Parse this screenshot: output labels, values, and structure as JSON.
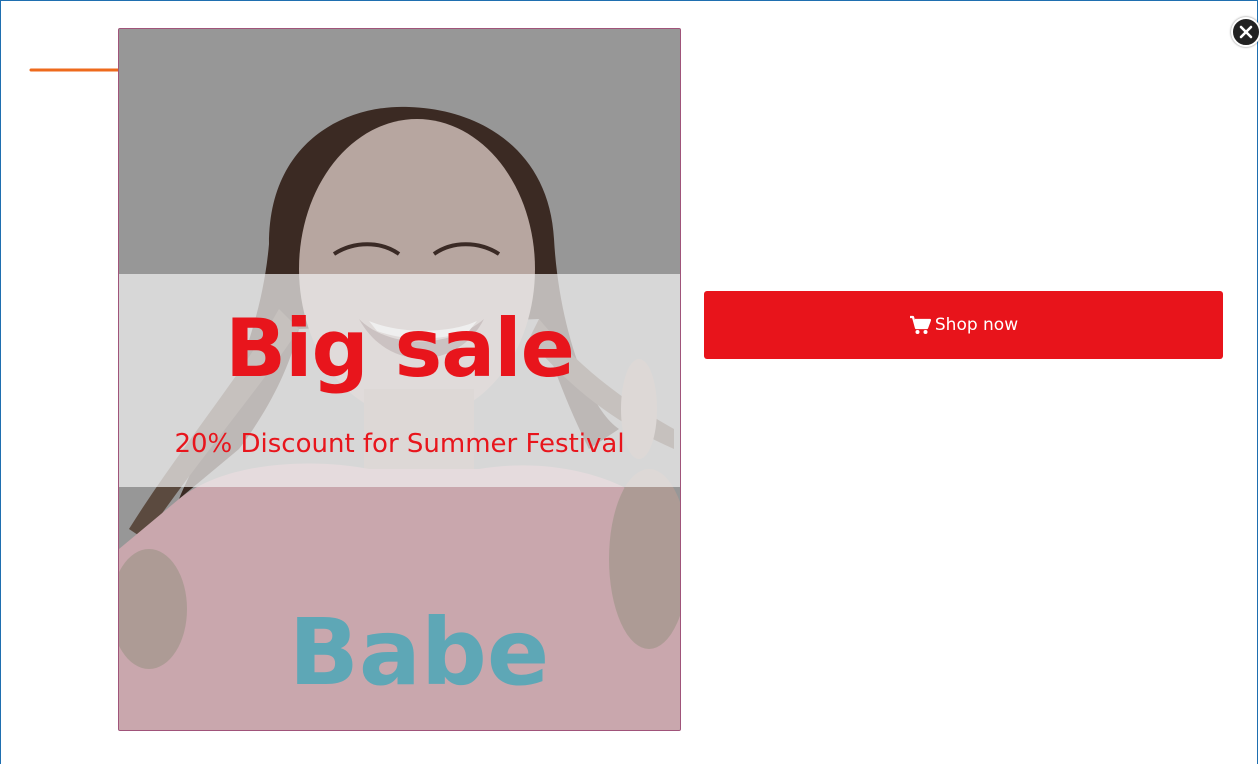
{
  "popup": {
    "headline": "Big sale",
    "subheadline": "20% Discount for Summer Festival",
    "shirt_text": "Babe",
    "button_label": "Shop now",
    "button_icon": "cart-icon",
    "close_icon": "close-icon",
    "pointer_icon": "arrow-right-icon"
  },
  "colors": {
    "accent": "#e8151c",
    "frame": "#1f6fb0",
    "arrow": "#ee6a1c",
    "image_overlay": "#989898"
  }
}
